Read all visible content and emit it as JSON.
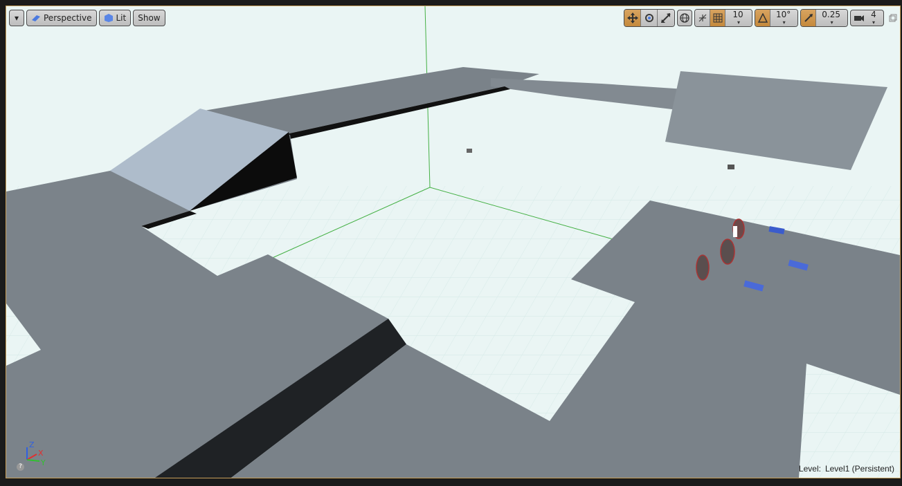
{
  "toolbar_left": {
    "menu_caret": "▾",
    "view_mode": "Perspective",
    "lighting_mode": "Lit",
    "show_label": "Show"
  },
  "toolbar_right": {
    "grid_snap_value": "10",
    "rotation_snap_value": "10°",
    "scale_snap_value": "0.25",
    "camera_speed_value": "4"
  },
  "status": {
    "level_label": "Level:",
    "level_name": "Level1 (Persistent)"
  },
  "axis_gizmo": {
    "z": "Z",
    "x": "X",
    "y": "Y",
    "help": "?"
  },
  "colors": {
    "accent_active": "#c5893c",
    "axis_x": "#e03030",
    "axis_y": "#30c030",
    "axis_z": "#3060e0",
    "floor_gray": "#7b838a",
    "ramp_top": "#aebccb"
  }
}
